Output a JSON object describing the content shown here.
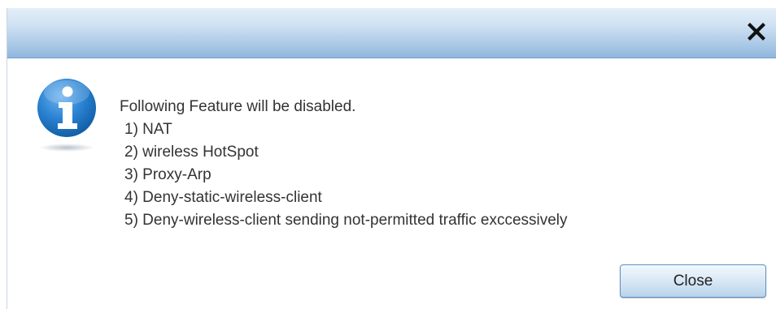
{
  "dialog": {
    "close_icon": "close-icon",
    "icon": "info-icon",
    "message": "Following Feature will be disabled.",
    "items": [
      "1) NAT",
      "2) wireless HotSpot",
      "3) Proxy-Arp",
      "4) Deny-static-wireless-client",
      "5) Deny-wireless-client sending not-permitted traffic exccessively"
    ],
    "close_button_label": "Close"
  },
  "colors": {
    "titlebar_top": "#e3eef8",
    "titlebar_bottom": "#8fb6dd",
    "icon_blue": "#1e73be",
    "text": "#333333"
  }
}
